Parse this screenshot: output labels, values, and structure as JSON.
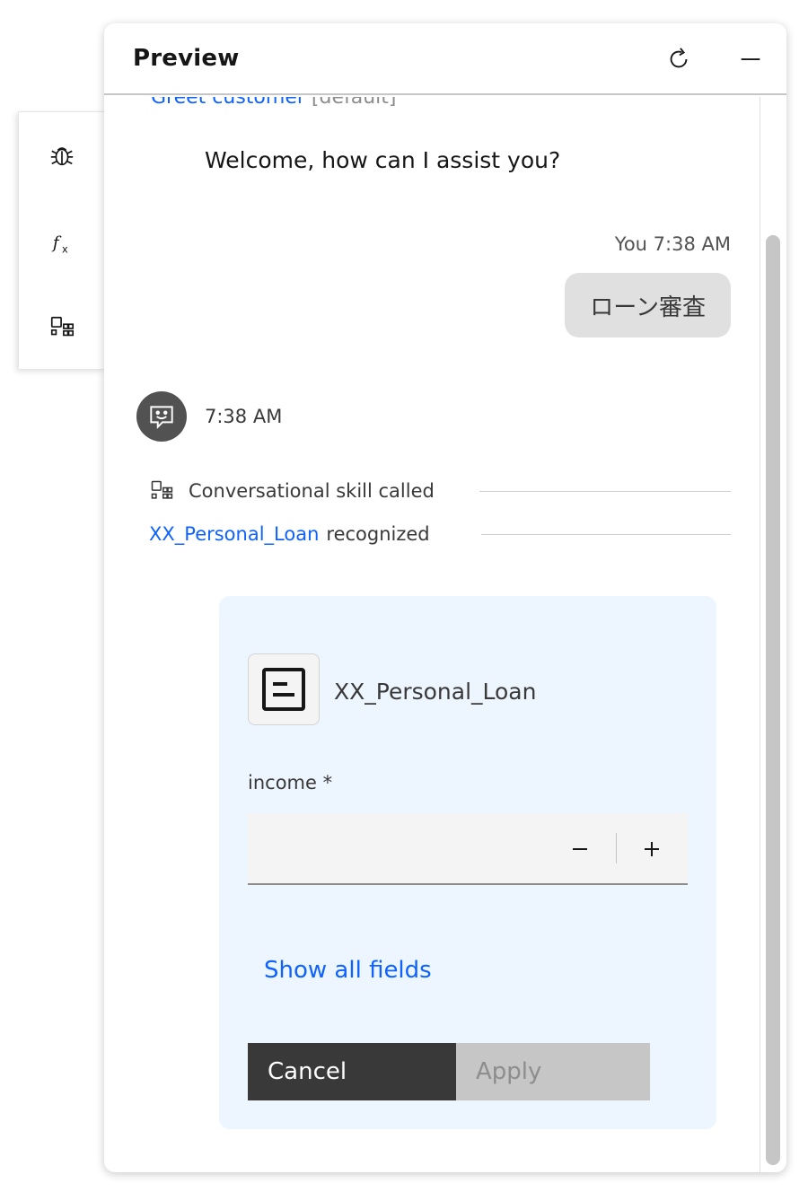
{
  "side_rail": {
    "items": [
      {
        "icon": "debug-icon"
      },
      {
        "icon": "function-icon"
      },
      {
        "icon": "skill-apps-icon"
      }
    ]
  },
  "panel": {
    "title": "Preview",
    "refresh_icon": "refresh-icon",
    "minimize_icon": "minimize-icon"
  },
  "conversation": {
    "partial_top_link": "Greet customer",
    "partial_top_suffix": "[default]",
    "bot_welcome": "Welcome, how can I assist you?",
    "user_meta": "You 7:38 AM",
    "user_message": "ローン審査",
    "bot_time": "7:38 AM",
    "events": [
      {
        "text": "Conversational skill called"
      },
      {
        "link": "XX_Personal_Loan",
        "text": "recognized"
      }
    ]
  },
  "form_card": {
    "name": "XX_Personal_Loan",
    "field_label": "income *",
    "field_value": "",
    "show_all_label": "Show all fields",
    "cancel_label": "Cancel",
    "apply_label": "Apply"
  },
  "colors": {
    "link": "#0f62fe",
    "card_bg": "#edf5ff",
    "cancel_bg": "#393939",
    "apply_bg": "#c6c6c6",
    "user_bubble": "#e0e0e0"
  }
}
